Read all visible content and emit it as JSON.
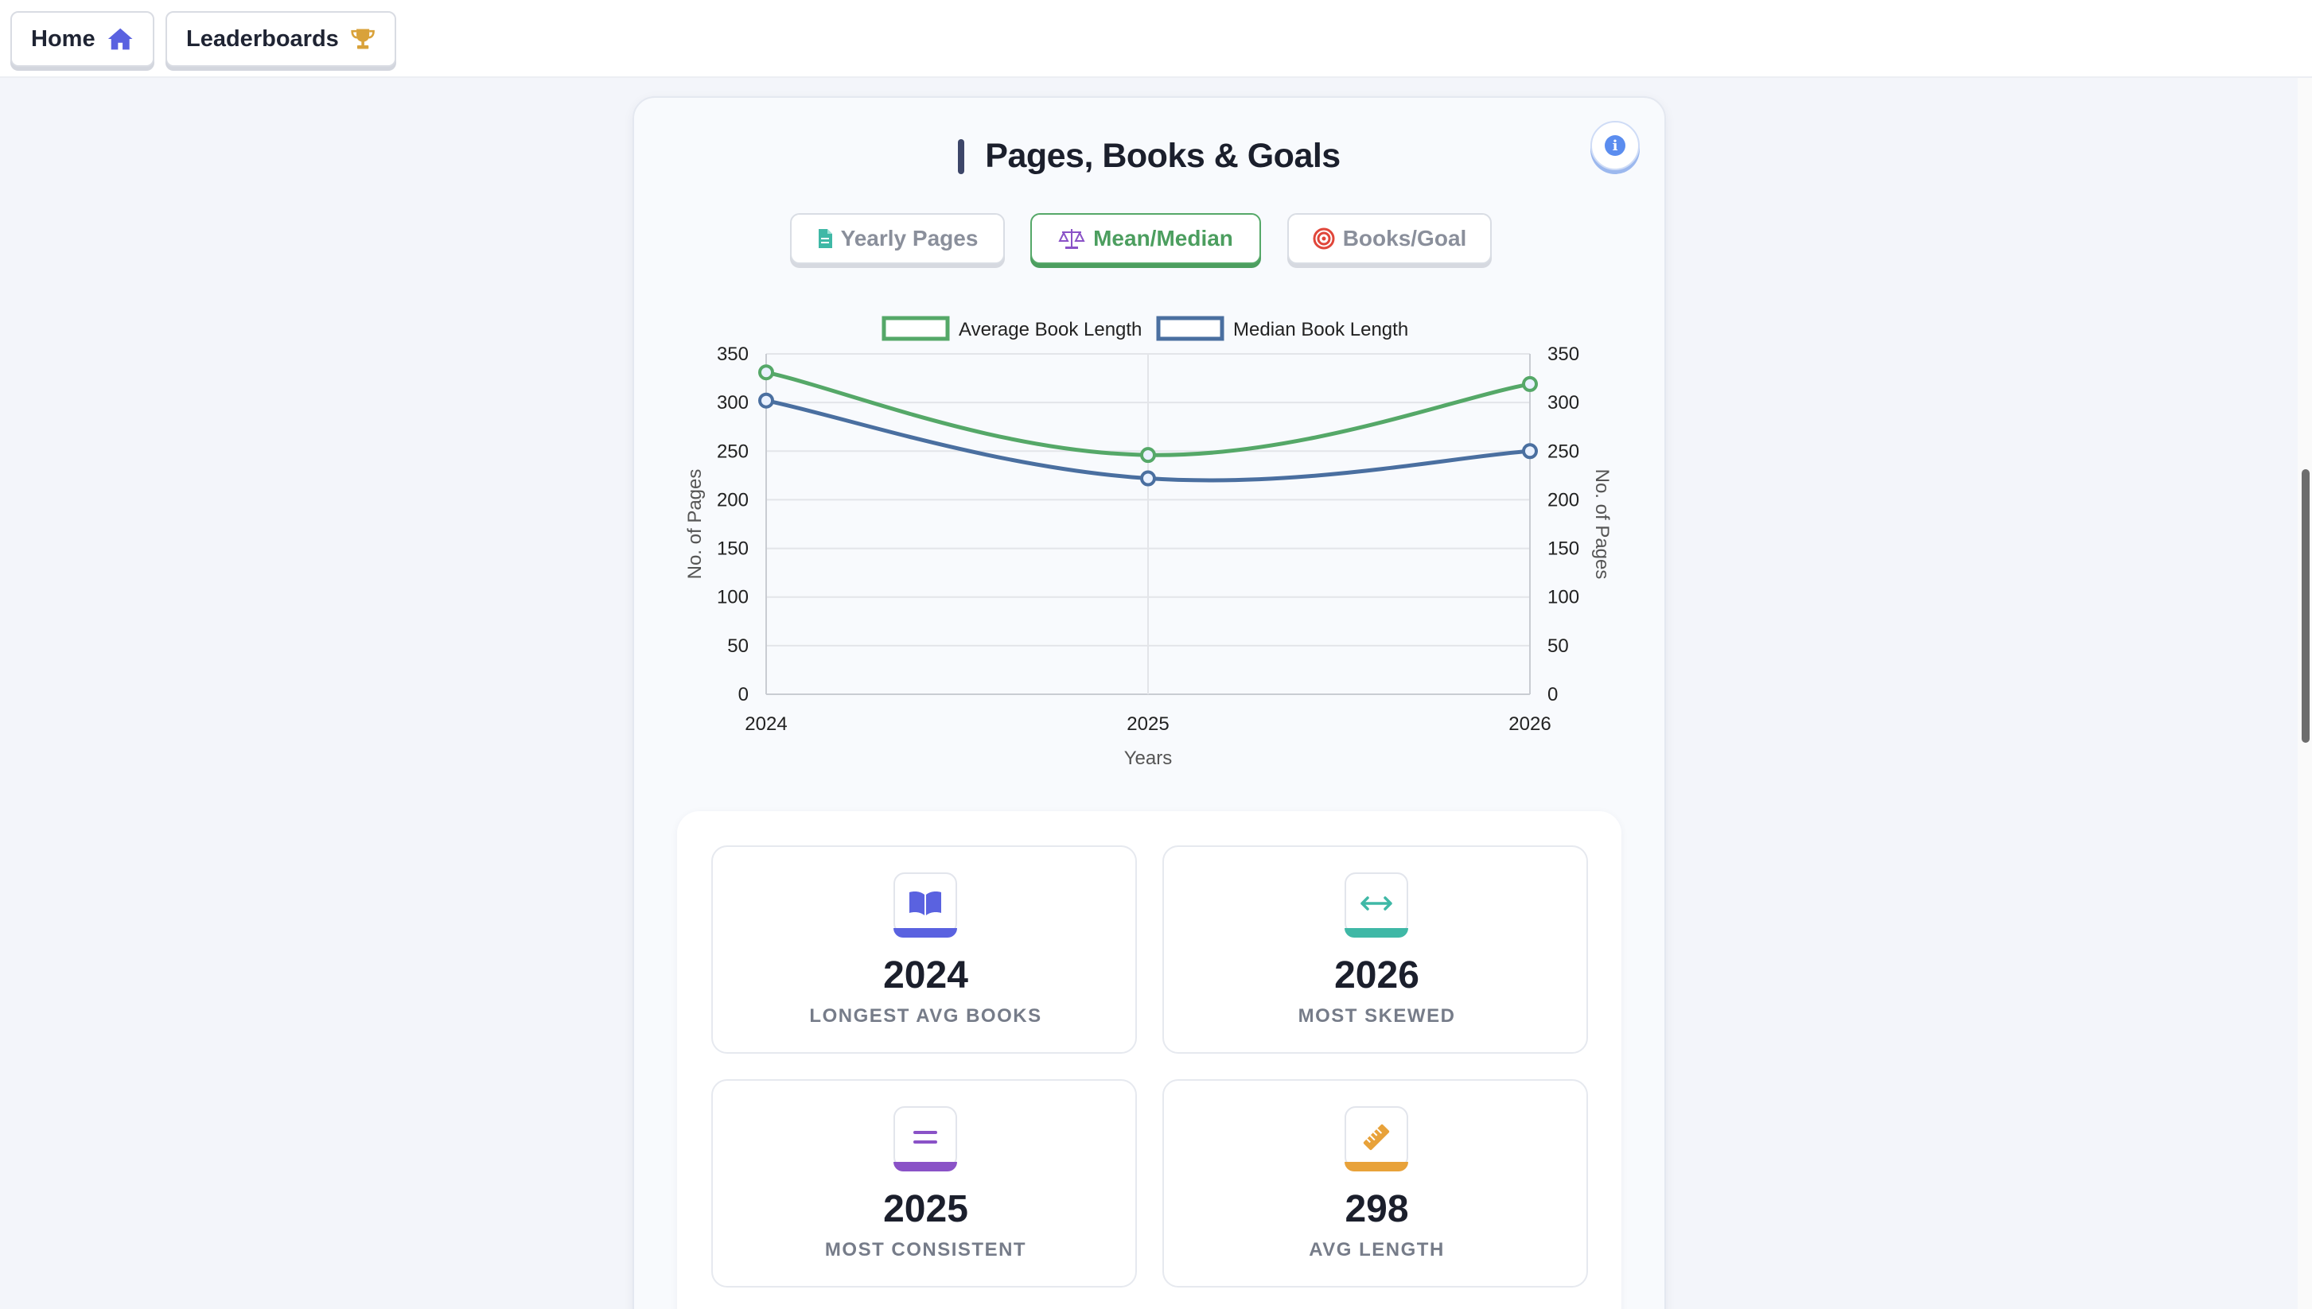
{
  "nav": {
    "home_label": "Home",
    "leaderboards_label": "Leaderboards"
  },
  "section": {
    "title": "Pages, Books & Goals",
    "tabs": [
      {
        "label": "Yearly Pages",
        "icon": "file-icon",
        "active": false
      },
      {
        "label": "Mean/Median",
        "icon": "scale-icon",
        "active": true
      },
      {
        "label": "Books/Goal",
        "icon": "target-icon",
        "active": false
      }
    ]
  },
  "colors": {
    "accent_green": "#55a868",
    "accent_blue": "#4a6fa0",
    "home_icon": "#5a62e0",
    "trophy": "#d9a23a",
    "yearly_icon": "#3fb8a6",
    "mean_icon": "#8a52c7",
    "goal_icon": "#e0463a"
  },
  "chart_data": {
    "type": "line",
    "x": [
      "2024",
      "2025",
      "2026"
    ],
    "series": [
      {
        "name": "Average Book Length",
        "values": [
          331,
          246,
          319
        ],
        "color": "#55a868"
      },
      {
        "name": "Median Book Length",
        "values": [
          302,
          222,
          250
        ],
        "color": "#4a6fa0"
      }
    ],
    "xlabel": "Years",
    "ylabel": "No. of Pages",
    "ylabel_right": "No. of Pages",
    "ylim": [
      0,
      350
    ],
    "yticks": [
      "0",
      "50",
      "100",
      "150",
      "200",
      "250",
      "300",
      "350"
    ],
    "grid": true,
    "legend": "top-center"
  },
  "stats": [
    {
      "value": "2024",
      "label": "LONGEST AVG BOOKS",
      "icon": "book-icon",
      "color": "#5a62e0"
    },
    {
      "value": "2026",
      "label": "MOST SKEWED",
      "icon": "arrows-horizontal-icon",
      "color": "#3fb8a6"
    },
    {
      "value": "2025",
      "label": "MOST CONSISTENT",
      "icon": "equals-icon",
      "color": "#8a52c7"
    },
    {
      "value": "298",
      "label": "AVG LENGTH",
      "icon": "ruler-icon",
      "color": "#e8a23a"
    }
  ]
}
